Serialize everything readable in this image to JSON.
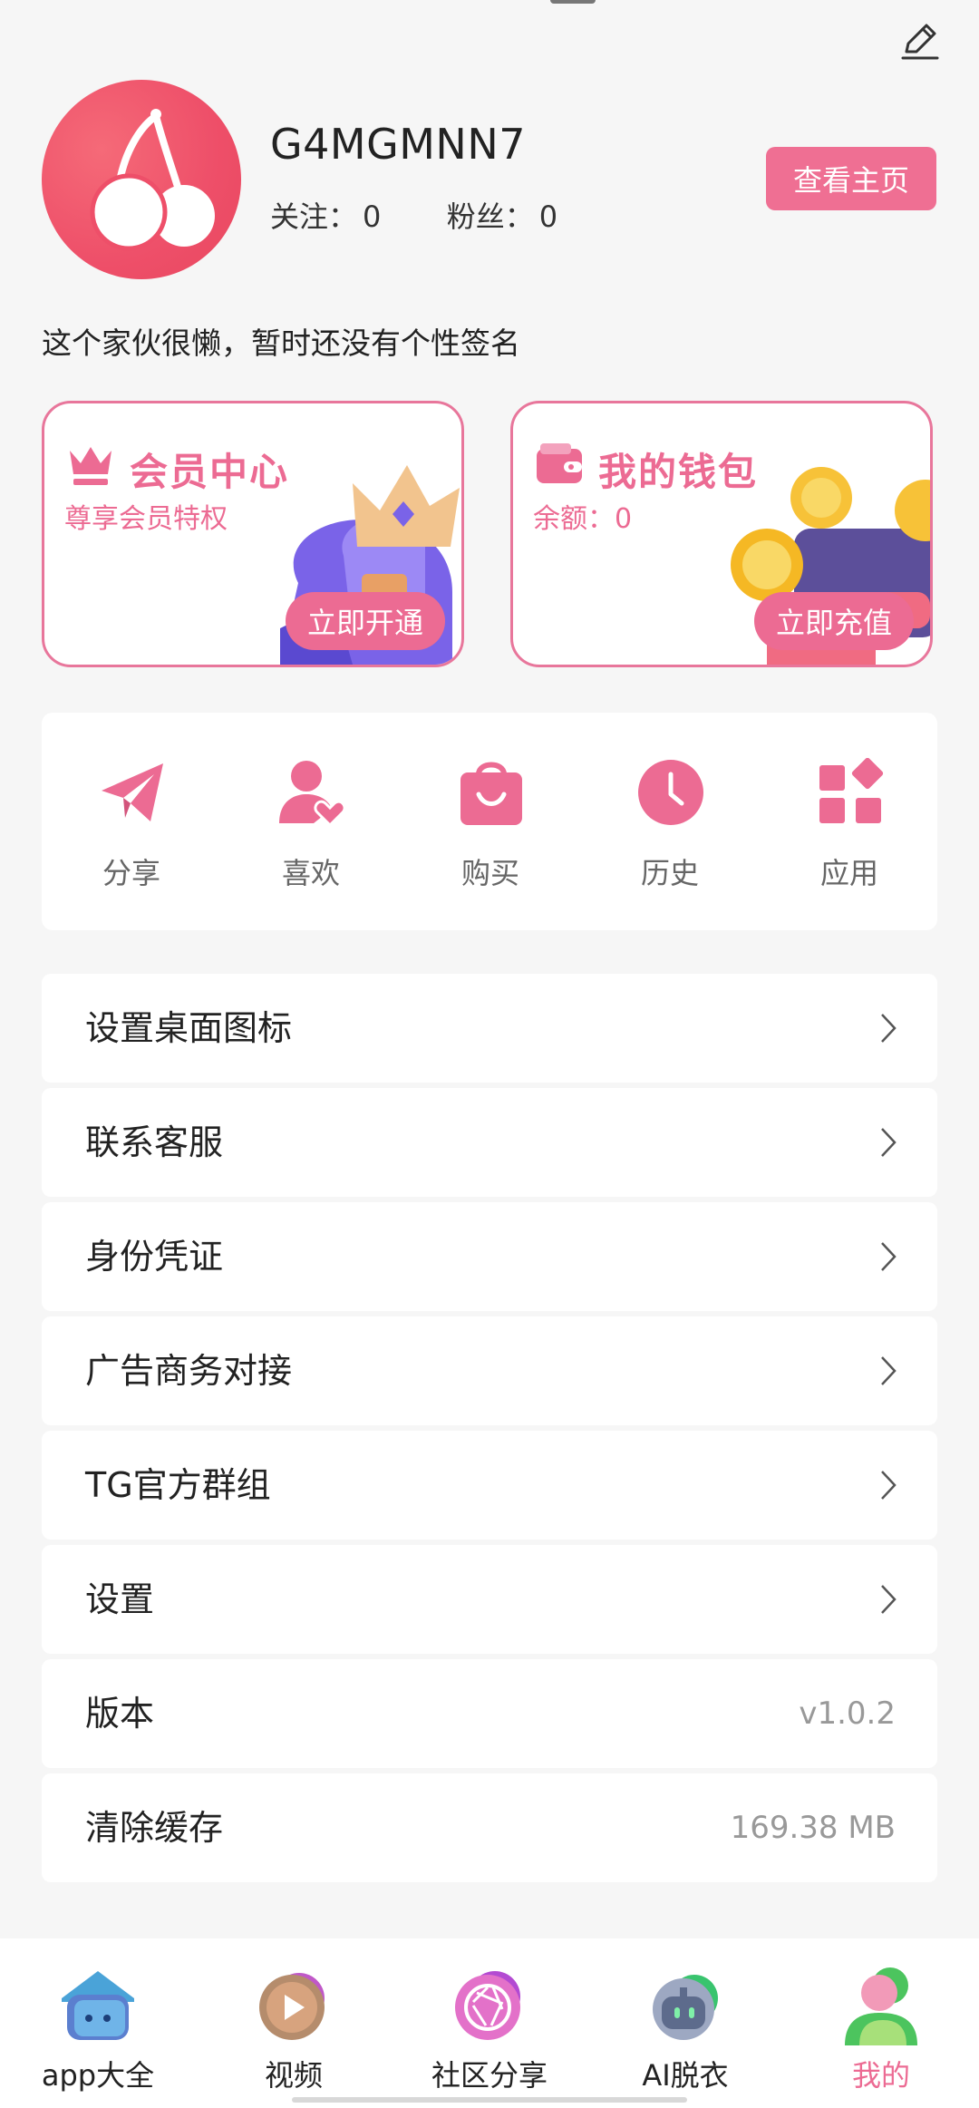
{
  "profile": {
    "username": "G4MGMNN7",
    "follow_label": "关注：",
    "follow_count": "0",
    "fans_label": "粉丝：",
    "fans_count": "0",
    "home_button": "查看主页",
    "signature": "这个家伙很懒，暂时还没有个性签名"
  },
  "cards": {
    "vip": {
      "title": "会员中心",
      "subtitle": "尊享会员特权",
      "button": "立即开通"
    },
    "wallet": {
      "title": "我的钱包",
      "subtitle": "余额：0",
      "button": "立即充值"
    }
  },
  "quick_actions": [
    {
      "label": "分享",
      "icon": "paper-plane-icon"
    },
    {
      "label": "喜欢",
      "icon": "user-heart-icon"
    },
    {
      "label": "购买",
      "icon": "shopping-bag-icon"
    },
    {
      "label": "历史",
      "icon": "clock-icon"
    },
    {
      "label": "应用",
      "icon": "apps-grid-icon"
    }
  ],
  "menu": [
    {
      "label": "设置桌面图标"
    },
    {
      "label": "联系客服"
    },
    {
      "label": "身份凭证"
    },
    {
      "label": "广告商务对接"
    },
    {
      "label": "TG官方群组"
    },
    {
      "label": "设置"
    },
    {
      "label": "版本",
      "value": "v1.0.2"
    },
    {
      "label": "清除缓存",
      "value": "169.38 MB"
    }
  ],
  "tabs": [
    {
      "label": "app大全",
      "icon": "house-app-icon"
    },
    {
      "label": "视频",
      "icon": "play-circle-icon"
    },
    {
      "label": "社区分享",
      "icon": "aperture-icon"
    },
    {
      "label": "AI脱衣",
      "icon": "robot-icon"
    },
    {
      "label": "我的",
      "icon": "person-icon",
      "active": true
    }
  ],
  "colors": {
    "accent": "#ec6b93",
    "avatar": "#ee4f69",
    "background": "#f6f6f6"
  }
}
